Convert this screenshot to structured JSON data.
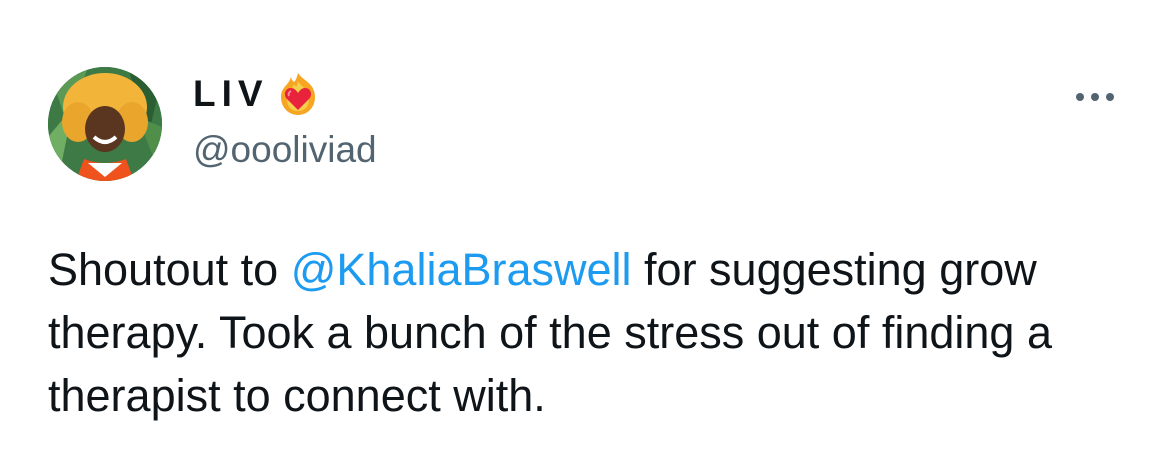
{
  "author": {
    "display_name": "LIV",
    "name_emoji": "heart-on-fire-emoji",
    "handle": "@oooliviad",
    "avatar": "profile-photo"
  },
  "menu": {
    "icon": "more-horizontal-icon"
  },
  "tweet": {
    "text_before": "Shoutout to ",
    "mention": "@KhaliaBraswell",
    "text_after": " for suggesting grow therapy. Took a bunch of the stress out of finding a therapist to connect with."
  },
  "colors": {
    "text": "#0f1419",
    "secondary": "#536471",
    "link": "#1d9bf0"
  }
}
